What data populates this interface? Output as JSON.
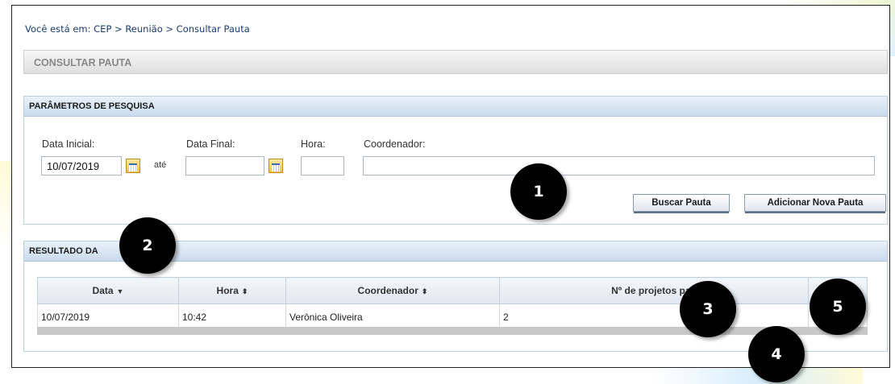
{
  "breadcrumb": {
    "prefix": "Você está em:",
    "trail": "CEP > Reunião > Consultar Pauta"
  },
  "page_title": "CONSULTAR PAUTA",
  "search_panel": {
    "heading": "PARÂMETROS DE PESQUISA",
    "start_date_label": "Data Inicial:",
    "start_date_value": "10/07/2019",
    "until_label": "até",
    "end_date_label": "Data Final:",
    "end_date_value": "",
    "hour_label": "Hora:",
    "hour_value": "",
    "coordinator_label": "Coordenador:",
    "coordinator_value": "",
    "search_button": "Buscar Pauta",
    "add_button": "Adicionar Nova Pauta"
  },
  "results_panel": {
    "heading": "RESULTADO DA",
    "columns": [
      "Data",
      "Hora",
      "Coordenador",
      "Nº de projetos pau",
      ""
    ],
    "sort_glyphs": [
      "▼",
      "⬍",
      "⬍",
      "",
      ""
    ],
    "rows": [
      [
        "10/07/2019",
        "10:42",
        "Verônica Oliveira",
        "2",
        ""
      ]
    ]
  },
  "callouts": [
    "1",
    "2",
    "3",
    "4",
    "5"
  ]
}
